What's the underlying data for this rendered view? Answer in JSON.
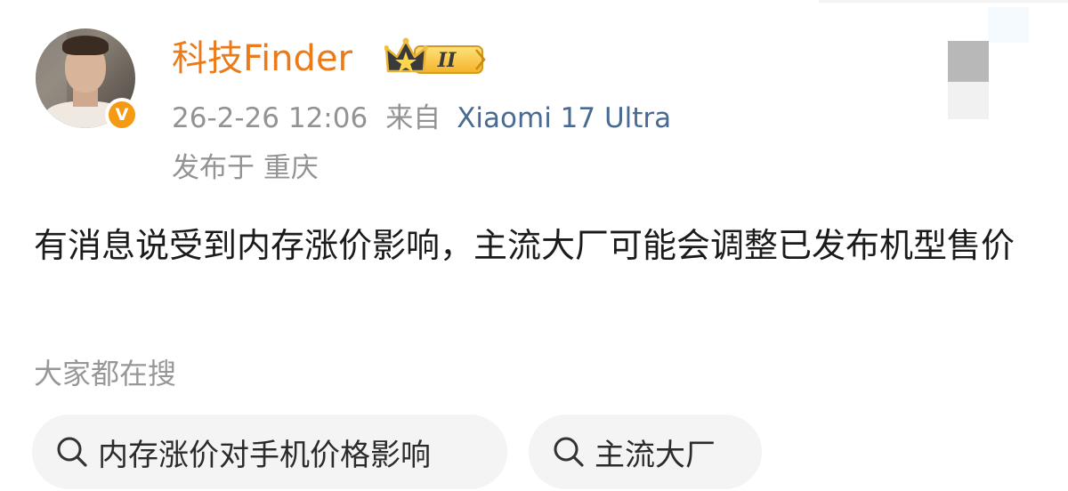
{
  "post": {
    "author": "科技Finder",
    "level_badge": "II",
    "time": "26-2-26 12:06",
    "from_label": "来自",
    "device": "Xiaomi 17 Ultra",
    "location": "发布于 重庆",
    "text": "有消息说受到内存涨价影响，主流大厂可能会调整已发布机型售价",
    "verified_mark": "V"
  },
  "search": {
    "label": "大家都在搜",
    "chips": [
      {
        "text": "内存涨价对手机价格影响",
        "icon": "search-icon"
      },
      {
        "text": "主流大厂",
        "icon": "search-icon"
      }
    ]
  },
  "colors": {
    "username": "#eb7a18",
    "device": "#4a6b91",
    "meta": "#939393",
    "verified": "#f59a12",
    "chip_bg": "#f4f4f4"
  }
}
